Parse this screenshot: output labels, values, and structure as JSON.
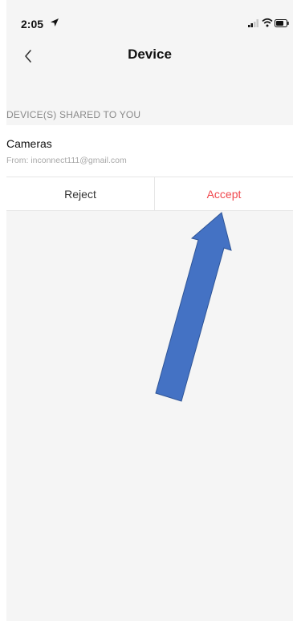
{
  "status_bar": {
    "time": "2:05",
    "icons": [
      "location-arrow-icon",
      "signal-icon",
      "wifi-icon",
      "battery-icon"
    ]
  },
  "nav": {
    "title": "Device",
    "back_icon": "chevron-left-icon"
  },
  "section_header": "DEVICE(S) SHARED TO YOU",
  "shared_device": {
    "name": "Cameras",
    "from": "From: inconnect111@gmail.com",
    "reject_label": "Reject",
    "accept_label": "Accept"
  },
  "colors": {
    "accent": "#f0484e",
    "background": "#f5f5f5",
    "annotation_arrow": "#4472c4"
  }
}
